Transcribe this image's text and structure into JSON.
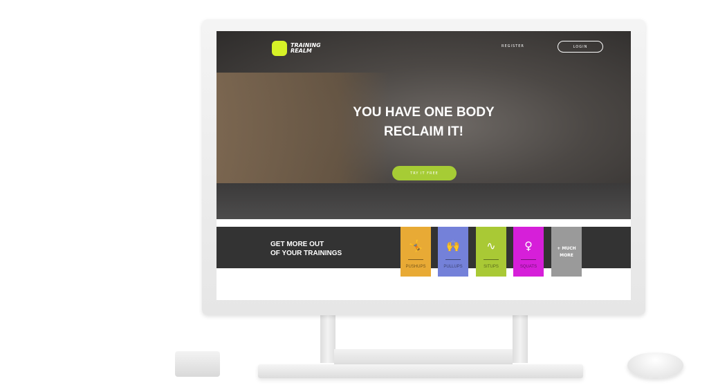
{
  "site": {
    "logo_line1": "TRAINING",
    "logo_line2": "REALM",
    "accent": "#d7f227"
  },
  "nav": {
    "register": "REGISTER",
    "login": "LOGIN"
  },
  "hero": {
    "headline_line1": "YOU HAVE ONE BODY",
    "headline_line2": "RECLAIM IT!",
    "cta": "TRY IT FREE",
    "cta_color": "#a6cc35"
  },
  "band": {
    "line1": "GET MORE OUT",
    "line2": "OF YOUR TRAININGS"
  },
  "tiles": [
    {
      "label": "PUSHUPS",
      "color": "#e8aa35",
      "icon": "pushup-icon"
    },
    {
      "label": "PULLUPS",
      "color": "#7481d9",
      "icon": "pullup-icon"
    },
    {
      "label": "SITUPS",
      "color": "#a9c935",
      "icon": "situp-icon"
    },
    {
      "label": "SQUATS",
      "color": "#d61fd9",
      "icon": "squat-icon"
    },
    {
      "label_line1": "+ MUCH",
      "label_line2": "MORE",
      "color": "#9a9a9a"
    }
  ]
}
